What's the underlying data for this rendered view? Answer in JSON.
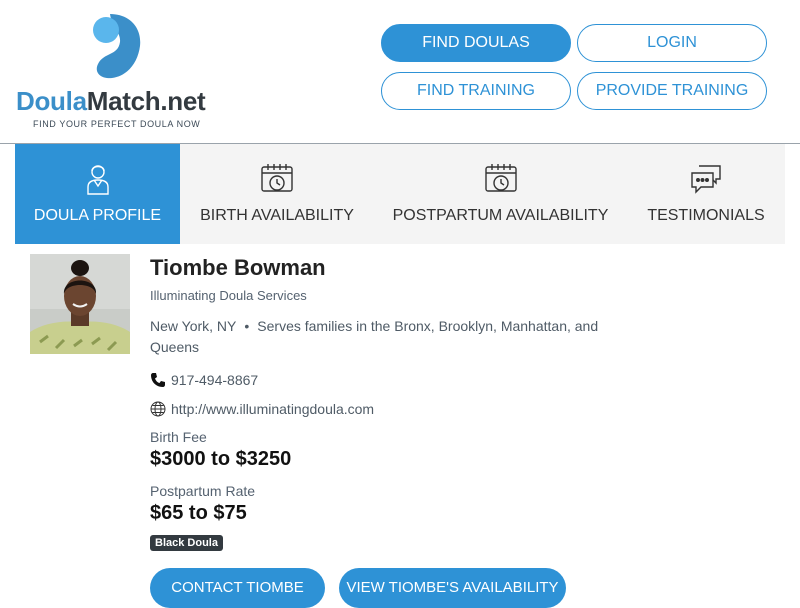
{
  "header": {
    "logo_part1": "Doula",
    "logo_part2": "Match.net",
    "tagline": "FIND YOUR PERFECT DOULA NOW",
    "nav": {
      "find_doulas": "FIND DOULAS",
      "login": "LOGIN",
      "find_training": "FIND TRAINING",
      "provide_training": "PROVIDE TRAINING"
    }
  },
  "tabs": [
    {
      "label": "DOULA PROFILE",
      "icon": "doula-person-icon",
      "active": true
    },
    {
      "label": "BIRTH AVAILABILITY",
      "icon": "calendar-clock-icon",
      "active": false
    },
    {
      "label": "POSTPARTUM AVAILABILITY",
      "icon": "calendar-clock-icon",
      "active": false
    },
    {
      "label": "TESTIMONIALS",
      "icon": "chat-bubbles-icon",
      "active": false
    }
  ],
  "profile": {
    "name": "Tiombe Bowman",
    "business": "Illuminating Doula Services",
    "city": "New York, NY",
    "separator": "•",
    "service_area": "Serves families in the Bronx, Brooklyn, Manhattan, and Queens",
    "phone": "917-494-8867",
    "website": "http://www.illuminatingdoula.com",
    "birth_fee_label": "Birth Fee",
    "birth_fee": "$3000 to $3250",
    "postpartum_label": "Postpartum Rate",
    "postpartum_rate": "$65 to $75",
    "badge": "Black Doula",
    "contact_button": "CONTACT TIOMBE",
    "availability_button": "VIEW TIOMBE'S AVAILABILITY"
  },
  "colors": {
    "accent": "#2e92d6",
    "logo_blue": "#3b8fc9",
    "tab_bg": "#f4f4f4",
    "badge_bg": "#333a40"
  }
}
